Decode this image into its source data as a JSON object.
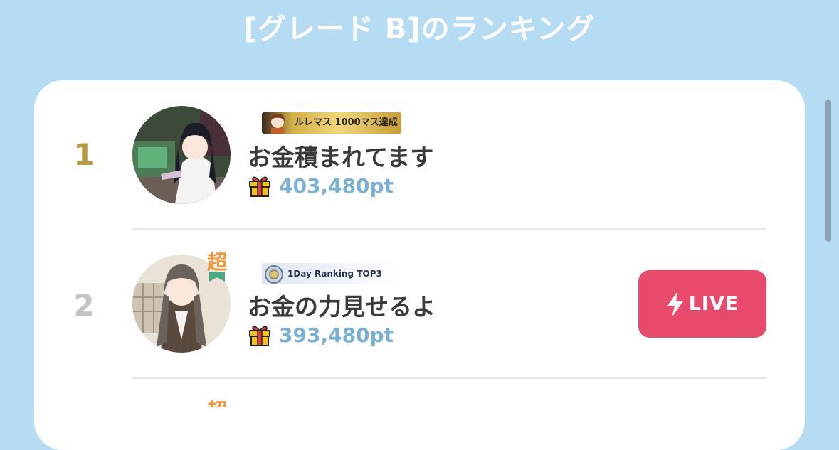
{
  "header": {
    "title": "[グレード B]のランキング"
  },
  "colors": {
    "background": "#b5dcf2",
    "rank1": "#b59a3f",
    "rank2": "#c4c4c4",
    "points": "#7ab0d4",
    "live": "#e84a6b",
    "chou_badge": "#f3943a"
  },
  "ranking": [
    {
      "rank": "1",
      "name": "お金積まれてます",
      "points": "403,480pt",
      "badge": {
        "text_main": "ルレマス",
        "text_sub": "1000マス達成"
      }
    },
    {
      "rank": "2",
      "name": "お金の力見せるよ",
      "points": "393,480pt",
      "badge": {
        "text_main": "1Day Ranking",
        "text_sub": "TOP3"
      },
      "chou_label": "超",
      "live": {
        "label": "LIVE",
        "icon": "lightning-icon"
      }
    },
    {
      "chou_label": "超"
    }
  ]
}
